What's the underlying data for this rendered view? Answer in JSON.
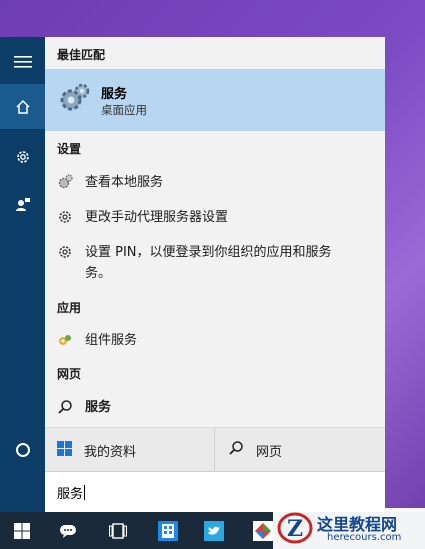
{
  "section_best": "最佳匹配",
  "best_match": {
    "title": "服务",
    "subtitle": "桌面应用"
  },
  "section_settings": "设置",
  "settings_items": [
    "查看本地服务",
    "更改手动代理服务器设置",
    "设置 PIN，以便登录到你组织的应用和服务",
    "务。"
  ],
  "section_apps": "应用",
  "app_item": "组件服务",
  "section_web": "网页",
  "web_item": "服务",
  "my_stuff": "我的资料",
  "web_button": "网页",
  "search_value": "服务",
  "watermark": {
    "title": "这里教程网",
    "url": "herecours.com"
  },
  "colors": {
    "rail": "#0c3d66",
    "selected": "#b7d6f1",
    "taskbar": "#1b2a3a"
  }
}
